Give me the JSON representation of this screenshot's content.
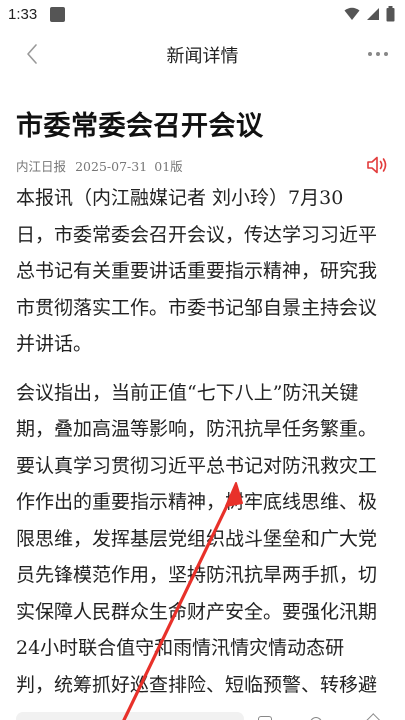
{
  "status_bar": {
    "time": "1:33",
    "battery_label": "Battery"
  },
  "nav": {
    "title": "新闻详情"
  },
  "article": {
    "title": "市委常委会召开会议",
    "meta": {
      "source": "内江日报",
      "date": "2025-07-31",
      "page": "01版"
    },
    "paragraphs": [
      {
        "lines": [
          "本报讯（内江融媒记者  刘小玲）7月30",
          "日，市委常委会召开会议，传达学习习近平",
          "总书记有关重要讲话重要指示精神，研究我",
          "市贯彻落实工作。市委书记邹自景主持会议",
          "并讲话。"
        ]
      },
      {
        "lines": [
          "会议指出，当前正值“七下八上”防汛关键",
          "期，叠加高温等影响，防汛抗旱任务繁重。",
          "要认真学习贯彻习近平总书记对防汛救灾工",
          "作作出的重要指示精神，树牢底线思维、极",
          "限思维，发挥基层党组织战斗堡垒和广大党",
          "员先锋模范作用，坚持防汛抗旱两手抓，切",
          "实保障人民群众生命财产安全。要强化汛期",
          "24小时联合值守和雨情汛情灾情动态研",
          "判，统筹抓好巡查排险、短临预警、转移避"
        ]
      }
    ]
  },
  "colors": {
    "speaker_icon": "#e23b3b",
    "arrow": "#e8312a",
    "meta_text": "#777777"
  },
  "icons": {
    "back": "chevron-left-icon",
    "more": "more-dots-icon",
    "speaker": "speaker-icon"
  }
}
